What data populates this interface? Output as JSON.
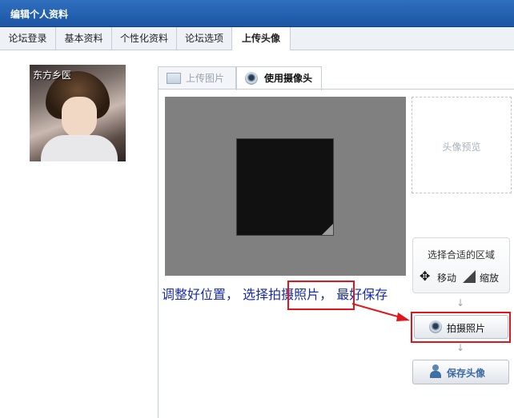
{
  "window": {
    "title": "编辑个人资料"
  },
  "tabs": [
    {
      "label": "论坛登录"
    },
    {
      "label": "基本资料"
    },
    {
      "label": "个性化资料"
    },
    {
      "label": "论坛选项"
    },
    {
      "label": "上传头像"
    }
  ],
  "avatar": {
    "caption": "东方乡医"
  },
  "upload_tabs": [
    {
      "label": "上传图片",
      "icon": "image-icon"
    },
    {
      "label": "使用摄像头",
      "icon": "webcam-icon"
    }
  ],
  "preview": {
    "label": "头像预览"
  },
  "select_area": {
    "title": "选择合适的区域",
    "move_label": "移动",
    "zoom_label": "缩放"
  },
  "buttons": {
    "shoot_label": "拍摄照片",
    "save_label": "保存头像"
  },
  "annotation": {
    "part1": "调整好位置，  选择",
    "highlight": "拍摄照片",
    "part2": "，  最好保存"
  },
  "colors": {
    "title_bar": "#1f5aa8",
    "annotation_text": "#1a2da8",
    "highlight_red": "#e0161c"
  }
}
